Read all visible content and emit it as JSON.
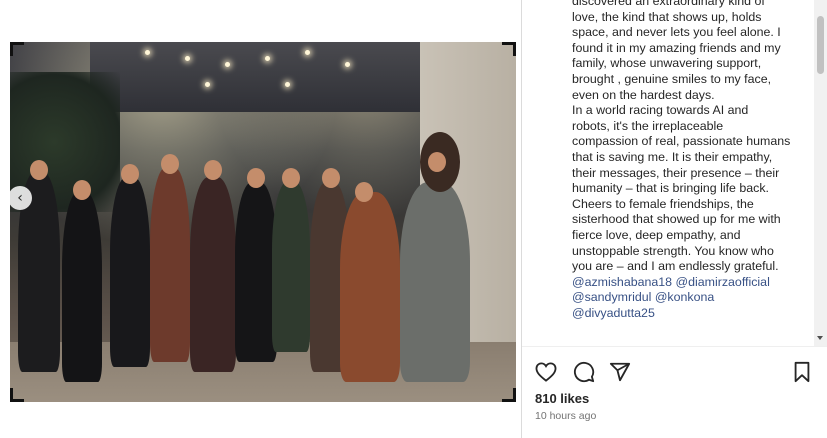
{
  "caption": {
    "lines": [
      "discovered an extraordinary kind of",
      "love, the kind that shows up, holds",
      "space, and never lets you feel alone. I",
      "found it in my amazing friends and my",
      "family, whose unwavering support,",
      "brought , genuine smiles to my face,",
      "even on the hardest days.",
      "In a world racing towards AI and",
      "robots, it's the irreplaceable",
      "compassion of real, passionate humans",
      "that is saving me. It is their empathy,",
      "their messages, their presence – their",
      "humanity – that is bringing life back.",
      "Cheers to female friendships, the",
      "sisterhood that showed up for me with",
      "fierce  love, deep empathy, and",
      "unstoppable strength. You know who",
      "you are – and I am endlessly grateful."
    ],
    "mentions_line1": [
      "@azmishabana18",
      "@diamirzaofficial"
    ],
    "mentions_line2": [
      "@sandymridul",
      "@konkona"
    ],
    "mentions_line3": [
      "@divyadutta25"
    ]
  },
  "post": {
    "likes": "810 likes",
    "time": "10 hours ago"
  },
  "icons": {
    "like": "heart-icon",
    "comment": "comment-icon",
    "share": "send-icon",
    "save": "bookmark-icon",
    "prev": "chevron-left-icon"
  },
  "colors": {
    "text": "#262626",
    "mention": "#385185",
    "muted": "#737373",
    "divider": "#dbdbdb"
  }
}
